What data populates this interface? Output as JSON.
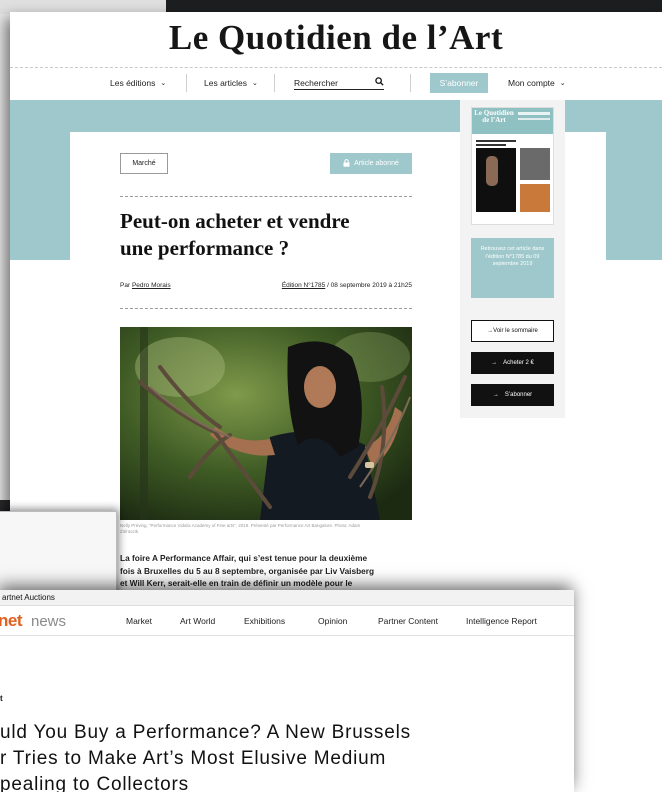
{
  "quotidien": {
    "masthead": "Le Quotidien de l’Art",
    "nav": {
      "editions": "Les éditions",
      "articles": "Les articles",
      "search_label": "Rechercher",
      "subscribe": "S’abonner",
      "account": "Mon compte"
    },
    "article": {
      "category": "Marché",
      "subscriber_badge": "Article abonné",
      "title_line1": "Peut-on acheter et vendre",
      "title_line2": "une performance ?",
      "by_prefix": "Par",
      "author": "Pedro Morais",
      "edition": "Édition N°1785",
      "date": "/ 08 septembre 2019 à 21h25",
      "caption": "Nelly Préving, “Performance Vidalix Academy of Fine arts”, 2019. Présenté par Performance Art Bangalore. Photo: Adam Zölntozik.",
      "lead_line1": "La foire A Performance Affair, qui s’est tenue pour la deuxième",
      "lead_line2": "fois à Bruxelles du 5 au 8 septembre, organisée par Liv Vaisberg",
      "lead_line3": "et Will Kerr, serait-elle en train de définir un modèle pour le"
    },
    "sidebar": {
      "cover_title": "Le Quotidien de l’Art",
      "promo": "Retrouvez cet article dans l’édition N°1785 du 09 septembre 2019",
      "summary_button": "Voir le sommaire",
      "buy_button": "Acheter 2 €",
      "subscribe_button": "S’abonner"
    }
  },
  "artnet": {
    "top_bar": "artnet Auctions",
    "logo_net": "net",
    "logo_news": "news",
    "nav": [
      "Market",
      "Art World",
      "Exhibitions",
      "Opinion",
      "Partner Content",
      "Intelligence Report"
    ],
    "kicker": "t",
    "headline_line1": "uld You Buy a Performance? A New Brussels",
    "headline_line2": "r Tries to Make Art’s Most Elusive Medium",
    "headline_line3": "pealing to Collectors"
  },
  "colors": {
    "teal": "#9ec8cb",
    "artnet_orange": "#e0611f"
  }
}
